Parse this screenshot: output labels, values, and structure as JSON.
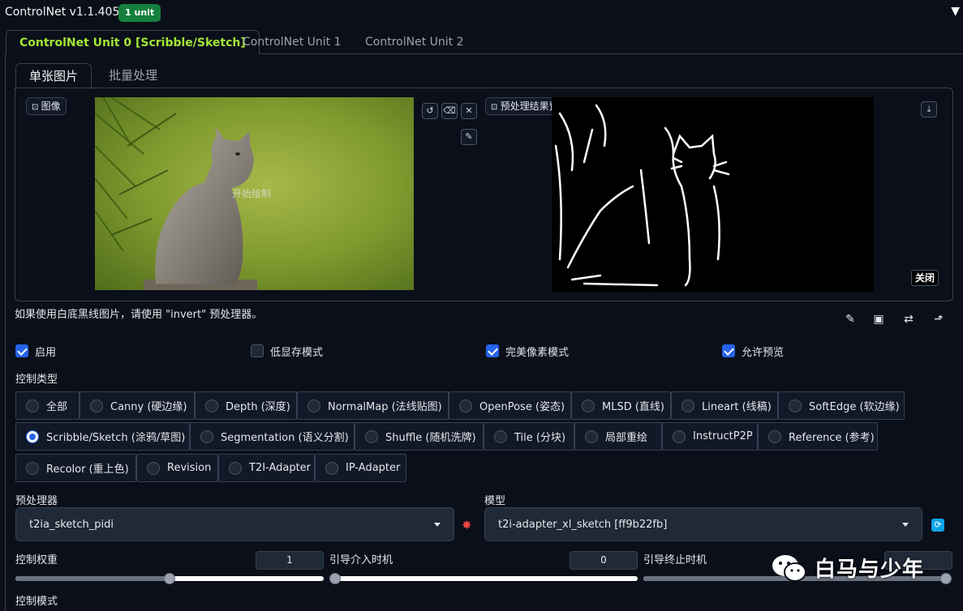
{
  "header": {
    "title": "ControlNet v1.1.405",
    "badge": "1 unit"
  },
  "unit_tabs": [
    "ControlNet Unit 0 [Scribble/Sketch]",
    "ControlNet Unit 1",
    "ControlNet Unit 2"
  ],
  "sub_tabs": [
    "单张图片",
    "批量处理"
  ],
  "image_panel": {
    "source_label": "图像",
    "draw_hint": "开始绘制",
    "preview_label": "预处理结果预览",
    "close_label": "关闭"
  },
  "hint": "如果使用白底黑线图片，请使用 \"invert\" 预处理器。",
  "checkboxes": [
    {
      "label": "启用",
      "checked": true
    },
    {
      "label": "低显存模式",
      "checked": false
    },
    {
      "label": "完美像素模式",
      "checked": true
    },
    {
      "label": "允许预览",
      "checked": true
    }
  ],
  "control_type": {
    "label": "控制类型",
    "selected": "Scribble/Sketch (涂鸦/草图)",
    "options": [
      "全部",
      "Canny (硬边缘)",
      "Depth (深度)",
      "NormalMap (法线贴图)",
      "OpenPose (姿态)",
      "MLSD (直线)",
      "Lineart (线稿)",
      "SoftEdge (软边缘)",
      "Scribble/Sketch (涂鸦/草图)",
      "Segmentation (语义分割)",
      "Shuffle (随机洗牌)",
      "Tile (分块)",
      "局部重绘",
      "InstructP2P",
      "Reference (参考)",
      "Recolor (重上色)",
      "Revision",
      "T2I-Adapter",
      "IP-Adapter"
    ]
  },
  "preprocessor": {
    "label": "预处理器",
    "value": "t2ia_sketch_pidi"
  },
  "model": {
    "label": "模型",
    "value": "t2i-adapter_xl_sketch [ff9b22fb]"
  },
  "sliders": {
    "weight": {
      "label": "控制权重",
      "value": "1",
      "fraction": 0.5
    },
    "start": {
      "label": "引导介入时机",
      "value": "0",
      "fraction": 0.0
    },
    "end": {
      "label": "引导终止时机",
      "value": "",
      "fraction": 1.0
    }
  },
  "control_mode_label": "控制模式",
  "watermark": "白马与少年",
  "colors": {
    "accent_green": "#a3e635",
    "badge_green": "#15803d",
    "checkbox_blue": "#2563eb",
    "background": "#0b0f19"
  }
}
